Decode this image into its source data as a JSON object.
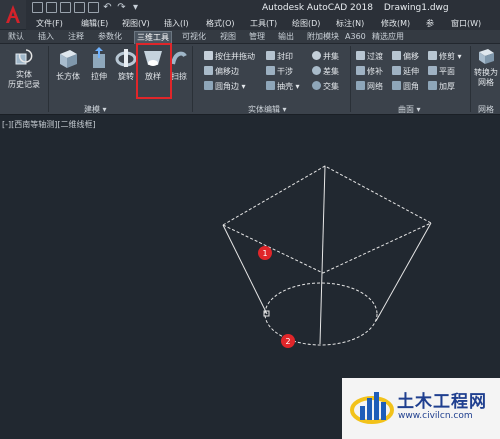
{
  "window": {
    "app_title": "Autodesk AutoCAD 2018",
    "file_name": "Drawing1.dwg"
  },
  "menu": [
    "文件(F)",
    "编辑(E)",
    "视图(V)",
    "插入(I)",
    "格式(O)",
    "工具(T)",
    "绘图(D)",
    "标注(N)",
    "修改(M)",
    "参",
    "窗口(W)"
  ],
  "tabs": [
    "默认",
    "插入",
    "注释",
    "参数化",
    "三维工具",
    "可视化",
    "视图",
    "管理",
    "输出",
    "附加模块",
    "A360",
    "精选应用"
  ],
  "active_tab": "三维工具",
  "ribbon": {
    "panel_modeling": "建模",
    "panel_solid_edit": "实体编辑",
    "panel_surface": "曲面",
    "panel_mesh": "网格",
    "history": "实体\n历史记录",
    "box": "长方体",
    "extrude": "拉伸",
    "revolve": "旋转",
    "loft": "放样",
    "sweep": "扫掠",
    "press_pull": "按住并拖动",
    "offset_edge": "偏移边",
    "fillet_edge": "圆角边",
    "imprint": "封印",
    "interfere": "干涉",
    "shell": "抽壳",
    "union": "并集",
    "subtract": "差集",
    "intersect": "交集",
    "blend": "过渡",
    "patch": "修补",
    "network": "网络",
    "offset": "偏移",
    "extend": "延伸",
    "fillet": "圆角",
    "trim": "修剪",
    "planar": "平面",
    "thicken": "加厚",
    "to_mesh": "转换为\n网格"
  },
  "viewport_label": "[-][西南等轴测][二维线框]",
  "markers": [
    "1",
    "2"
  ],
  "watermark": {
    "title": "土木工程网",
    "url": "www.civilcn.com"
  },
  "colors": {
    "canvas": "#212830",
    "highlight": "#e0262a",
    "marker": "#e0262a",
    "wire": "#e6e6e6"
  }
}
